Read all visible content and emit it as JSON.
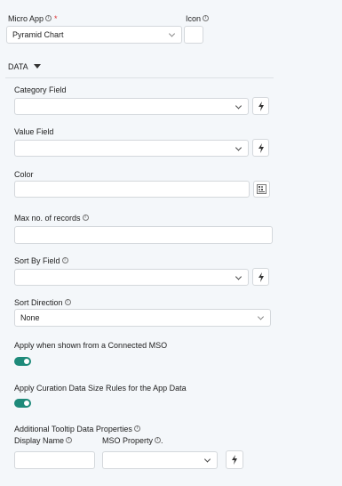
{
  "micro_app": {
    "label": "Micro App",
    "required_mark": "*",
    "value": "Pyramid Chart"
  },
  "icon": {
    "label": "Icon"
  },
  "section": {
    "label": "DATA"
  },
  "category_field": {
    "label": "Category Field"
  },
  "value_field": {
    "label": "Value Field"
  },
  "color": {
    "label": "Color"
  },
  "max_records": {
    "label": "Max no. of records"
  },
  "sort_by_field": {
    "label": "Sort By Field"
  },
  "sort_direction": {
    "label": "Sort Direction",
    "value": "None"
  },
  "apply_connected_mso": {
    "label": "Apply when shown from a Connected MSO",
    "enabled": true
  },
  "apply_curation": {
    "label": "Apply Curation Data Size Rules for the App Data",
    "enabled": true
  },
  "tooltip": {
    "label": "Additional Tooltip Data Properties",
    "display_name_label": "Display Name",
    "mso_property_label": "MSO Property",
    "mso_property_suffix": "."
  },
  "icons": {
    "info": "info-icon",
    "bolt": "lightning-bolt-icon",
    "palette": "color-palette-icon",
    "caret": "caret-down-icon"
  },
  "colors": {
    "toggle_on": "#1e8a7a",
    "required": "#dd3333"
  }
}
